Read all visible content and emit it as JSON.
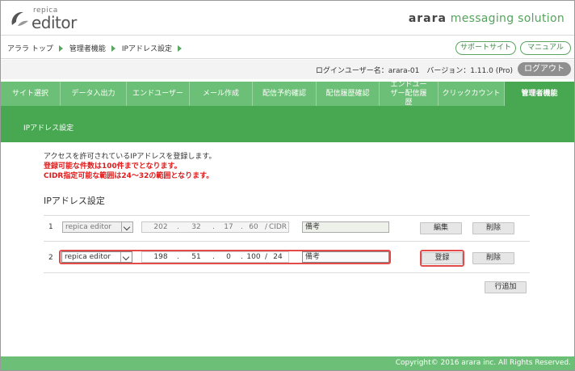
{
  "header": {
    "logo_small": "repica",
    "logo_big": "editor",
    "brand_bold": "arara",
    "brand_rest": "messaging solution",
    "brand_color": "#55a35c"
  },
  "breadcrumb": {
    "items": [
      "アララ トップ",
      "管理者機能",
      "IPアドレス設定"
    ],
    "support_label": "サポートサイト",
    "manual_label": "マニュアル"
  },
  "login": {
    "text": "ログインユーザー名：arara-01　バージョン：1.11.0 (Pro)",
    "logout_label": "ログアウト"
  },
  "nav": {
    "items": [
      {
        "label": "サイト選択"
      },
      {
        "label": "データ入出力"
      },
      {
        "label": "エンドユーザー"
      },
      {
        "label": "メール作成"
      },
      {
        "label": "配信予約確認"
      },
      {
        "label": "配信履歴確認"
      },
      {
        "label": "エンドユーザー配信履歴"
      },
      {
        "label": "クリックカウント"
      },
      {
        "label": "管理者機能"
      }
    ],
    "active_color": "#47a851",
    "bar_color": "#6cbf76"
  },
  "banner": {
    "title": "IPアドレス設定"
  },
  "content": {
    "desc1": "アクセスを許可されているIPアドレスを登録します。",
    "desc2": "登録可能な件数は100件までとなります。",
    "desc3": "CIDR指定可能な範囲は24〜32の範囲となります。",
    "section_title": "IPアドレス設定",
    "rows": [
      {
        "num": "1",
        "type": "repica editor",
        "ip": [
          "202",
          "32",
          "17",
          "60"
        ],
        "cidr": "CIDR",
        "note": "備考",
        "primary_label": "編集",
        "delete_label": "削除"
      },
      {
        "num": "2",
        "type": "repica editor",
        "ip": [
          "198",
          "51",
          "0",
          "100"
        ],
        "cidr": "24",
        "note": "備考",
        "primary_label": "登録",
        "delete_label": "削除"
      }
    ],
    "add_row_label": "行追加"
  },
  "footer": {
    "copyright": "Copyright© 2016 arara inc. All Rights Reserved."
  }
}
